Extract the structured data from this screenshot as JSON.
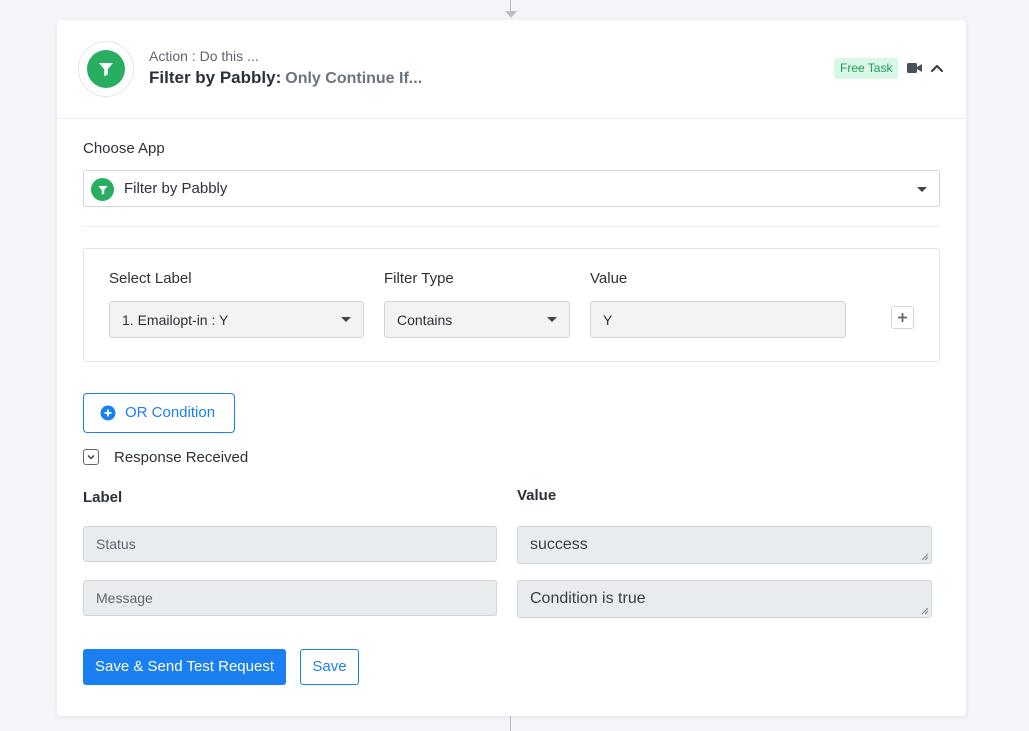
{
  "header": {
    "action_caption": "Action : Do this ...",
    "app_name": "Filter by Pabbly:",
    "step_subtitle": "Only Continue If...",
    "badge": "Free Task",
    "icons": {
      "logo": "filter-funnel-icon",
      "video": "video-camera-icon",
      "collapse": "chevron-up-icon"
    },
    "accent_color": "#27ae60"
  },
  "choose_app": {
    "label": "Choose App",
    "selected": "Filter by Pabbly"
  },
  "filter": {
    "columns": {
      "select_label": "Select Label",
      "filter_type": "Filter Type",
      "value": "Value"
    },
    "row": {
      "select_label": "1. Emailopt-in : Y",
      "filter_type": "Contains",
      "value": "Y"
    }
  },
  "or_condition": {
    "label": "OR Condition"
  },
  "response": {
    "title": "Response Received",
    "label_header": "Label",
    "value_header": "Value",
    "rows": [
      {
        "label": "Status",
        "value": "success"
      },
      {
        "label": "Message",
        "value": "Condition is true"
      }
    ]
  },
  "actions": {
    "save_and_send": "Save & Send Test Request",
    "save": "Save",
    "primary_color": "#1a7ff0"
  }
}
